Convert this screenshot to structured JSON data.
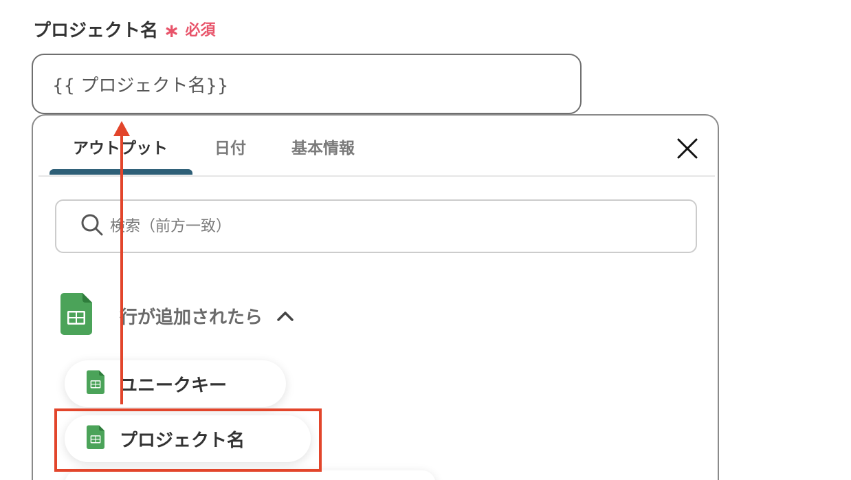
{
  "field": {
    "label": "プロジェクト名",
    "required_mark": "∗",
    "required_text": "必須",
    "value": "{{ プロジェクト名}}"
  },
  "panel": {
    "tabs": [
      {
        "label": "アウトプット",
        "active": true
      },
      {
        "label": "日付",
        "active": false
      },
      {
        "label": "基本情報",
        "active": false
      }
    ],
    "search": {
      "placeholder": "検索（前方一致）"
    },
    "group": {
      "title": "行が追加されたら",
      "expanded": true
    },
    "items": [
      {
        "label": "ユニークキー",
        "icon": "sheets-icon"
      },
      {
        "label": "プロジェクト名",
        "icon": "sheets-icon",
        "highlighted": true
      }
    ]
  },
  "colors": {
    "required": "#e8546a",
    "tab_underline": "#2e5f77",
    "sheets_green": "#4ba359",
    "annotation_red": "#e2452b"
  }
}
